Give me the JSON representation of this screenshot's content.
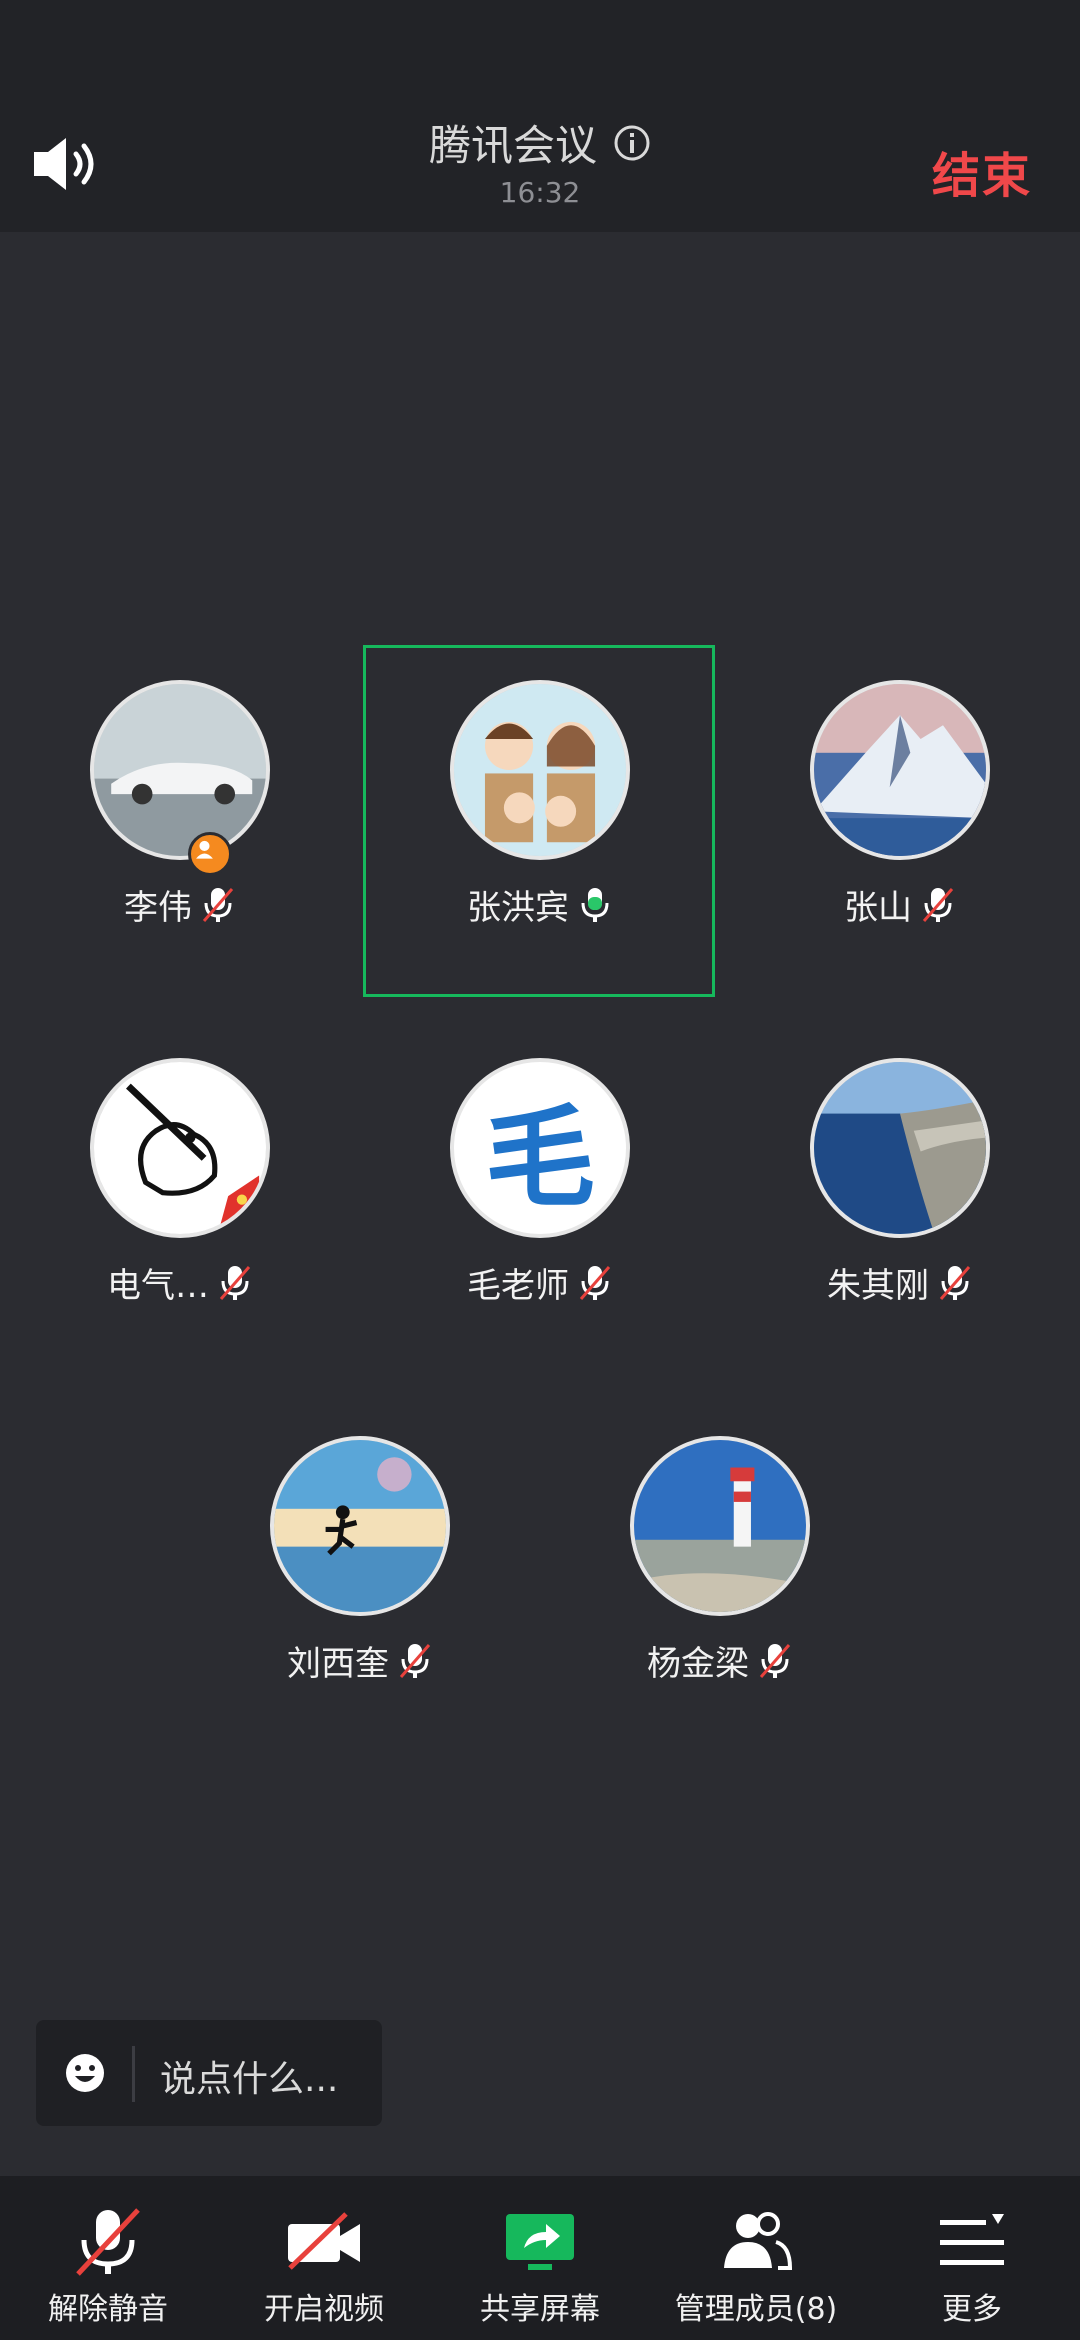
{
  "header": {
    "title": "腾讯会议",
    "time": "16:32",
    "end_label": "结束"
  },
  "participants": [
    {
      "name": "李伟",
      "mic": "muted",
      "host": true
    },
    {
      "name": "张洪宾",
      "mic": "speaking",
      "active": true
    },
    {
      "name": "张山",
      "mic": "muted"
    },
    {
      "name": "电气…",
      "mic": "muted"
    },
    {
      "name": "毛老师",
      "mic": "muted",
      "avatar_text": "毛"
    },
    {
      "name": "朱其刚",
      "mic": "muted"
    },
    {
      "name": "刘西奎",
      "mic": "muted"
    },
    {
      "name": "杨金梁",
      "mic": "muted"
    }
  ],
  "chat": {
    "placeholder": "说点什么..."
  },
  "toolbar": {
    "unmute": "解除静音",
    "video": "开启视频",
    "share": "共享屏幕",
    "members": "管理成员(8)",
    "more": "更多"
  },
  "colors": {
    "end": "#f0484a",
    "active_border": "#16b85c",
    "share_icon": "#16b85c",
    "host_badge": "#f58a1f",
    "mute_slash": "#e8413c"
  }
}
